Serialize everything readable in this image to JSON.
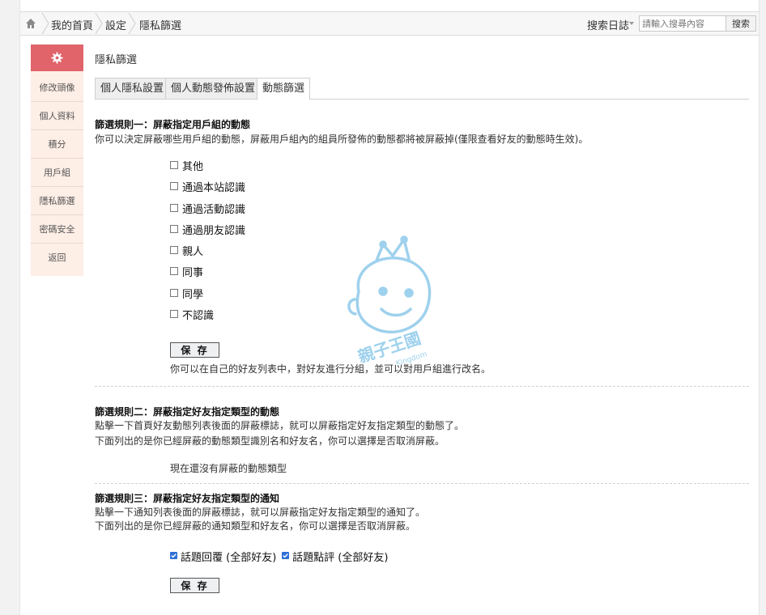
{
  "breadcrumb": {
    "items": [
      "我的首頁",
      "設定",
      "隱私篩選"
    ]
  },
  "search": {
    "label": "搜索日誌",
    "placeholder": "請輸入搜尋內容",
    "button": "搜索"
  },
  "sidebar": {
    "items": [
      {
        "label": "修改頭像"
      },
      {
        "label": "個人資料"
      },
      {
        "label": "積分"
      },
      {
        "label": "用戶組"
      },
      {
        "label": "隱私篩選"
      },
      {
        "label": "密碼安全"
      },
      {
        "label": "返回"
      }
    ]
  },
  "main": {
    "title": "隱私篩選",
    "tabs": [
      "個人隱私設置",
      "個人動態發佈設置",
      "動態篩選"
    ]
  },
  "rule1": {
    "title": "篩選規則一：屏蔽指定用戶組的動態",
    "desc": "你可以決定屏蔽哪些用戶組的動態，屏蔽用戶組內的組員所發佈的動態都將被屏蔽掉(僅限查看好友的動態時生效)。",
    "options": [
      "其他",
      "通過本站認識",
      "通過活動認識",
      "通過朋友認識",
      "親人",
      "同事",
      "同學",
      "不認識"
    ],
    "save": "保 存",
    "note": "你可以在自己的好友列表中，對好友進行分組，並可以對用戶組進行改名。"
  },
  "rule2": {
    "title": "篩選規則二：屏蔽指定好友指定類型的動態",
    "desc1": "點擊一下首頁好友動態列表後面的屏蔽標誌，就可以屏蔽指定好友指定類型的動態了。",
    "desc2": "下面列出的是你已經屏蔽的動態類型識別名和好友名，你可以選擇是否取消屏蔽。",
    "empty": "現在還沒有屏蔽的動態類型"
  },
  "rule3": {
    "title": "篩選規則三：屏蔽指定好友指定類型的通知",
    "desc1": "點擊一下通知列表後面的屏蔽標誌，就可以屏蔽指定好友指定類型的通知了。",
    "desc2": "下面列出的是你已經屏蔽的通知類型和好友名，你可以選擇是否取消屏蔽。",
    "options": [
      "話題回覆 (全部好友)",
      "話題點評 (全部好友)"
    ],
    "save": "保 存"
  },
  "watermark": {
    "text": "親子王國",
    "sub": "Kingdom"
  },
  "colors": {
    "sidebar_head": "#e0646a",
    "sidebar_bg": "#fdeee6",
    "checkbox_checked": "#2f6fd6",
    "watermark": "#8ec9ea"
  }
}
